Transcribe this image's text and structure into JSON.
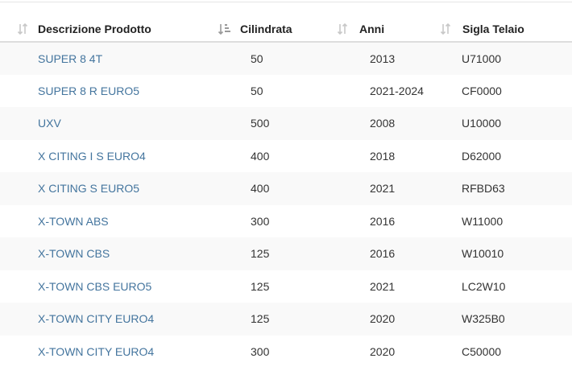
{
  "table": {
    "columns": [
      {
        "label": "Descrizione Prodotto",
        "sort": "none"
      },
      {
        "label": "Cilindrata",
        "sort": "active"
      },
      {
        "label": "Anni",
        "sort": "none"
      },
      {
        "label": "Sigla Telaio",
        "sort": "none"
      }
    ],
    "rows": [
      {
        "desc": "SUPER 8 4T",
        "cc": "50",
        "anni": "2013",
        "sigla": "U71000"
      },
      {
        "desc": "SUPER 8 R EURO5",
        "cc": "50",
        "anni": "2021-2024",
        "sigla": "CF0000"
      },
      {
        "desc": "UXV",
        "cc": "500",
        "anni": "2008",
        "sigla": "U10000"
      },
      {
        "desc": "X CITING I S EURO4",
        "cc": "400",
        "anni": "2018",
        "sigla": "D62000"
      },
      {
        "desc": "X CITING S EURO5",
        "cc": "400",
        "anni": "2021",
        "sigla": "RFBD63"
      },
      {
        "desc": "X-TOWN ABS",
        "cc": "300",
        "anni": "2016",
        "sigla": "W11000"
      },
      {
        "desc": "X-TOWN CBS",
        "cc": "125",
        "anni": "2016",
        "sigla": "W10010"
      },
      {
        "desc": "X-TOWN CBS EURO5",
        "cc": "125",
        "anni": "2021",
        "sigla": "LC2W10"
      },
      {
        "desc": "X-TOWN CITY EURO4",
        "cc": "125",
        "anni": "2020",
        "sigla": "W325B0"
      },
      {
        "desc": "X-TOWN CITY EURO4",
        "cc": "300",
        "anni": "2020",
        "sigla": "C50000"
      }
    ]
  },
  "icons": {
    "sort_inactive": "sort-arrows-icon",
    "sort_active": "sort-amount-down-icon"
  },
  "colors": {
    "link": "#44759e",
    "row_stripe": "#f9f9f9",
    "icon_inactive": "#c8c8c8",
    "icon_active": "#9a9a9a"
  }
}
